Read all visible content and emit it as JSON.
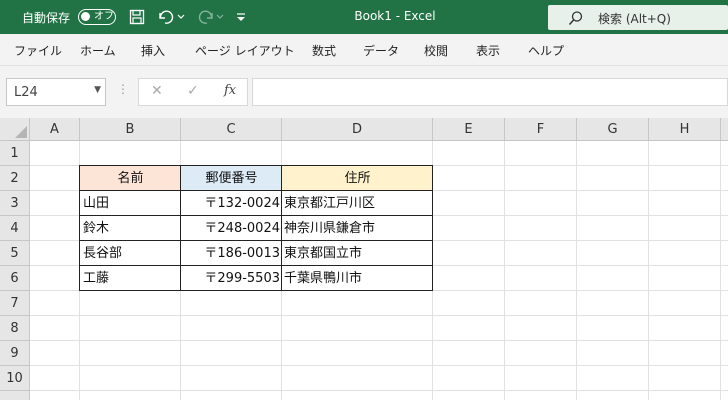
{
  "titlebar": {
    "autosave_label": "自動保存",
    "autosave_state": "オフ",
    "title": "Book1  -  Excel",
    "search_text": "検索 (Alt+Q)",
    "bg_color": "#217346"
  },
  "ribbon": {
    "tabs": [
      "ファイル",
      "ホーム",
      "挿入",
      "ページ レイアウト",
      "数式",
      "データ",
      "校閲",
      "表示",
      "ヘルプ"
    ]
  },
  "formula_bar": {
    "name_box": "L24",
    "fx_label": "fx",
    "formula": ""
  },
  "grid": {
    "columns": [
      "A",
      "B",
      "C",
      "D",
      "E",
      "F",
      "G",
      "H"
    ],
    "rows": [
      "1",
      "2",
      "3",
      "4",
      "5",
      "6",
      "7",
      "8",
      "9",
      "10"
    ],
    "table": {
      "headers": [
        {
          "text": "名前",
          "bg": "#fce4d6"
        },
        {
          "text": "郵便番号",
          "bg": "#ddebf7"
        },
        {
          "text": "住所",
          "bg": "#fff2cc"
        }
      ],
      "rows": [
        {
          "name": "山田",
          "zip": "〒132-0024",
          "address": "東京都江戸川区"
        },
        {
          "name": "鈴木",
          "zip": "〒248-0024",
          "address": "神奈川県鎌倉市"
        },
        {
          "name": "長谷部",
          "zip": "〒186-0013",
          "address": "東京都国立市"
        },
        {
          "name": "工藤",
          "zip": "〒299-5503",
          "address": "千葉県鴨川市"
        }
      ]
    }
  }
}
